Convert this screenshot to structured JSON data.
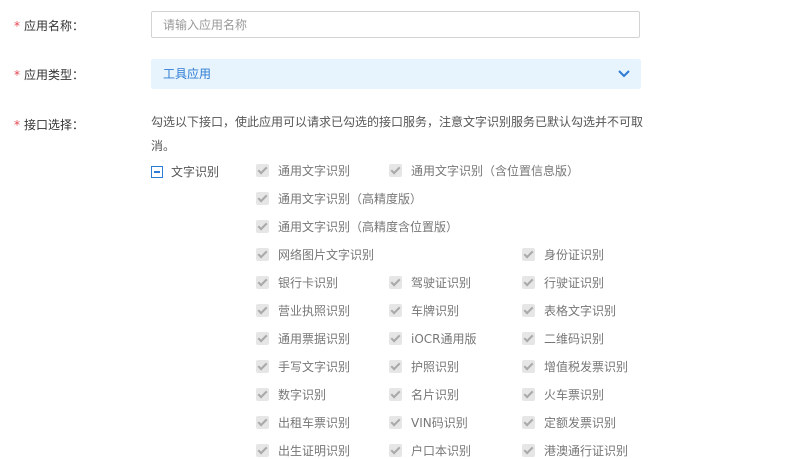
{
  "form": {
    "app_name": {
      "label": "应用名称：",
      "required_mark": "*",
      "placeholder": "请输入应用名称",
      "value": ""
    },
    "app_type": {
      "label": "应用类型：",
      "required_mark": "*",
      "selected": "工具应用",
      "icon": "chevron-down-icon"
    },
    "interfaces": {
      "label": "接口选择：",
      "required_mark": "*",
      "description": "勾选以下接口，使此应用可以请求已勾选的接口服务，注意文字识别服务已默认勾选并不可取消。",
      "group": {
        "label": "文字识别",
        "state": "indeterminate"
      },
      "options": [
        {
          "label": "通用文字识别",
          "checked": true,
          "disabled": true
        },
        {
          "label": "通用文字识别（含位置信息版）",
          "checked": true,
          "disabled": true
        },
        {
          "label": "通用文字识别（高精度版）",
          "checked": true,
          "disabled": true
        },
        {
          "label": "通用文字识别（高精度含位置版）",
          "checked": true,
          "disabled": true
        },
        {
          "label": "网络图片文字识别",
          "checked": true,
          "disabled": true
        },
        {
          "label": "身份证识别",
          "checked": true,
          "disabled": true
        },
        {
          "label": "银行卡识别",
          "checked": true,
          "disabled": true
        },
        {
          "label": "驾驶证识别",
          "checked": true,
          "disabled": true
        },
        {
          "label": "行驶证识别",
          "checked": true,
          "disabled": true
        },
        {
          "label": "营业执照识别",
          "checked": true,
          "disabled": true
        },
        {
          "label": "车牌识别",
          "checked": true,
          "disabled": true
        },
        {
          "label": "表格文字识别",
          "checked": true,
          "disabled": true
        },
        {
          "label": "通用票据识别",
          "checked": true,
          "disabled": true
        },
        {
          "label": "iOCR通用版",
          "checked": true,
          "disabled": true
        },
        {
          "label": "二维码识别",
          "checked": true,
          "disabled": true
        },
        {
          "label": "手写文字识别",
          "checked": true,
          "disabled": true
        },
        {
          "label": "护照识别",
          "checked": true,
          "disabled": true
        },
        {
          "label": "增值税发票识别",
          "checked": true,
          "disabled": true
        },
        {
          "label": "数字识别",
          "checked": true,
          "disabled": true
        },
        {
          "label": "名片识别",
          "checked": true,
          "disabled": true
        },
        {
          "label": "火车票识别",
          "checked": true,
          "disabled": true
        },
        {
          "label": "出租车票识别",
          "checked": true,
          "disabled": true
        },
        {
          "label": "VIN码识别",
          "checked": true,
          "disabled": true
        },
        {
          "label": "定额发票识别",
          "checked": true,
          "disabled": true
        },
        {
          "label": "出生证明识别",
          "checked": true,
          "disabled": true
        },
        {
          "label": "户口本识别",
          "checked": true,
          "disabled": true
        },
        {
          "label": "港澳通行证识别",
          "checked": true,
          "disabled": true
        }
      ]
    }
  },
  "colors": {
    "required": "#e64552",
    "accent": "#2d7bd4",
    "select_bg": "#e8f4fd"
  }
}
